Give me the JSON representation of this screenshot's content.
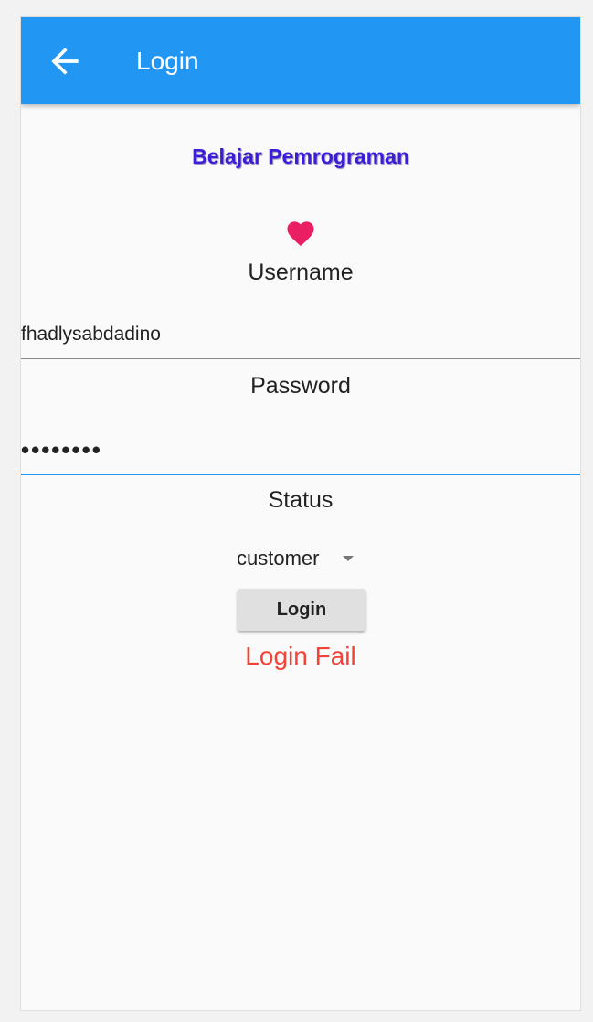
{
  "appbar": {
    "title": "Login",
    "back_icon": "arrow-back-icon",
    "color": "#2196f3"
  },
  "form": {
    "headline": "Belajar Pemrograman",
    "headline_color": "#3a1fd6",
    "heart_icon": "heart-icon",
    "heart_color": "#e91e63",
    "username_label": "Username",
    "username_value": "fhadlysabdadino",
    "password_label": "Password",
    "password_value": "12345678",
    "status_label": "Status",
    "status_selected": "customer",
    "login_button_label": "Login",
    "message": "Login Fail",
    "message_color": "#f44336"
  }
}
